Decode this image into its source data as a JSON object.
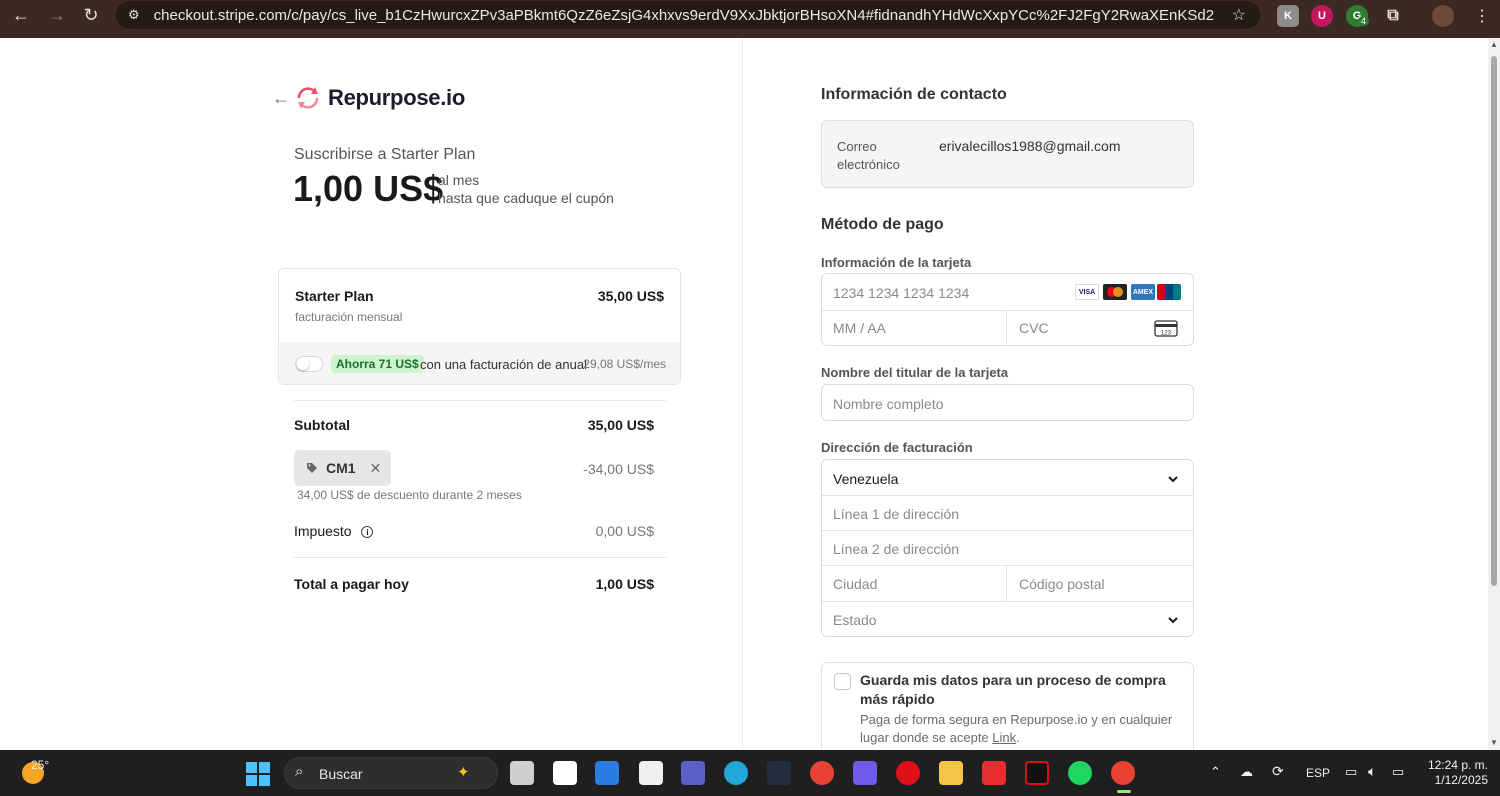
{
  "browser": {
    "url": "checkout.stripe.com/c/pay/cs_live_b1CzHwurcxZPv3aPBkmt6QzZ6eZsjG4xhxvs9erdV9XxJbktjorBHsoXN4#fidnandhYHdWcXxpYCc%2FJ2FgY2RwaXEnKSd2cGd2ZndsdXFsamtQa...",
    "extension_badge": "4"
  },
  "merchant": {
    "name": "Repurpose.io"
  },
  "summary": {
    "subscribe_title": "Suscribirse a Starter Plan",
    "price": "1,00 US$",
    "price_period": "al mes",
    "price_note": "hasta que caduque el cupón",
    "plan_name": "Starter Plan",
    "plan_billing": "facturación mensual",
    "plan_price": "35,00 US$",
    "annual_badge": "Ahorra 71 US$",
    "annual_text": "con una facturación de anual",
    "annual_price": "29,08 US$/mes",
    "subtotal_label": "Subtotal",
    "subtotal_value": "35,00 US$",
    "coupon_code": "CM1",
    "coupon_value": "-34,00 US$",
    "discount_note": "34,00 US$ de descuento durante 2 meses",
    "tax_label": "Impuesto",
    "tax_value": "0,00 US$",
    "total_label": "Total a pagar hoy",
    "total_value": "1,00 US$"
  },
  "contact": {
    "title": "Información de contacto",
    "email_label": "Correo electrónico",
    "email_value": "erivalecillos1988@gmail.com"
  },
  "payment": {
    "title": "Método de pago",
    "card_label": "Información de la tarjeta",
    "card_number_placeholder": "1234 1234 1234 1234",
    "expiry_placeholder": "MM / AA",
    "cvc_placeholder": "CVC",
    "card_brands": [
      "VISA",
      "Mastercard",
      "AMEX",
      "UnionPay"
    ],
    "holder_label": "Nombre del titular de la tarjeta",
    "holder_placeholder": "Nombre completo",
    "billing_label": "Dirección de facturación",
    "country": "Venezuela",
    "address1_placeholder": "Línea 1 de dirección",
    "address2_placeholder": "Línea 2 de dirección",
    "city_placeholder": "Ciudad",
    "postal_placeholder": "Código postal",
    "state_placeholder": "Estado",
    "save_title": "Guarda mis datos para un proceso de compra más rápido",
    "save_desc_prefix": "Paga de forma segura en Repurpose.io y en cualquier lugar donde se acepte ",
    "save_desc_link": "Link",
    "save_desc_suffix": "."
  },
  "taskbar": {
    "weather": "25°",
    "search": "Buscar",
    "language": "ESP",
    "time": "12:24 p. m.",
    "date": "1/12/2025"
  },
  "colors": {
    "browser_frame": "#3c2a22",
    "save_badge_bg": "#cdf5cf",
    "save_badge_text": "#1b6e2b",
    "logo_accent": "#e8536a"
  }
}
